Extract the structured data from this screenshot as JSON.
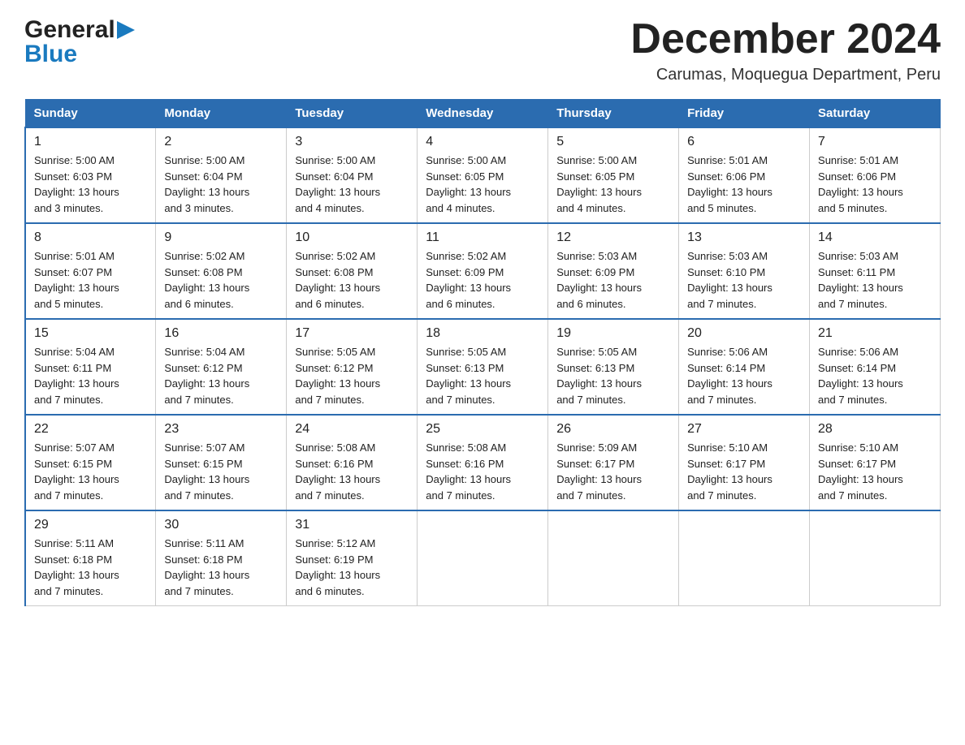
{
  "logo": {
    "general": "General",
    "blue": "Blue",
    "arrow": "▶"
  },
  "title": "December 2024",
  "subtitle": "Carumas, Moquegua Department, Peru",
  "headers": [
    "Sunday",
    "Monday",
    "Tuesday",
    "Wednesday",
    "Thursday",
    "Friday",
    "Saturday"
  ],
  "weeks": [
    [
      {
        "num": "1",
        "info": "Sunrise: 5:00 AM\nSunset: 6:03 PM\nDaylight: 13 hours\nand 3 minutes."
      },
      {
        "num": "2",
        "info": "Sunrise: 5:00 AM\nSunset: 6:04 PM\nDaylight: 13 hours\nand 3 minutes."
      },
      {
        "num": "3",
        "info": "Sunrise: 5:00 AM\nSunset: 6:04 PM\nDaylight: 13 hours\nand 4 minutes."
      },
      {
        "num": "4",
        "info": "Sunrise: 5:00 AM\nSunset: 6:05 PM\nDaylight: 13 hours\nand 4 minutes."
      },
      {
        "num": "5",
        "info": "Sunrise: 5:00 AM\nSunset: 6:05 PM\nDaylight: 13 hours\nand 4 minutes."
      },
      {
        "num": "6",
        "info": "Sunrise: 5:01 AM\nSunset: 6:06 PM\nDaylight: 13 hours\nand 5 minutes."
      },
      {
        "num": "7",
        "info": "Sunrise: 5:01 AM\nSunset: 6:06 PM\nDaylight: 13 hours\nand 5 minutes."
      }
    ],
    [
      {
        "num": "8",
        "info": "Sunrise: 5:01 AM\nSunset: 6:07 PM\nDaylight: 13 hours\nand 5 minutes."
      },
      {
        "num": "9",
        "info": "Sunrise: 5:02 AM\nSunset: 6:08 PM\nDaylight: 13 hours\nand 6 minutes."
      },
      {
        "num": "10",
        "info": "Sunrise: 5:02 AM\nSunset: 6:08 PM\nDaylight: 13 hours\nand 6 minutes."
      },
      {
        "num": "11",
        "info": "Sunrise: 5:02 AM\nSunset: 6:09 PM\nDaylight: 13 hours\nand 6 minutes."
      },
      {
        "num": "12",
        "info": "Sunrise: 5:03 AM\nSunset: 6:09 PM\nDaylight: 13 hours\nand 6 minutes."
      },
      {
        "num": "13",
        "info": "Sunrise: 5:03 AM\nSunset: 6:10 PM\nDaylight: 13 hours\nand 7 minutes."
      },
      {
        "num": "14",
        "info": "Sunrise: 5:03 AM\nSunset: 6:11 PM\nDaylight: 13 hours\nand 7 minutes."
      }
    ],
    [
      {
        "num": "15",
        "info": "Sunrise: 5:04 AM\nSunset: 6:11 PM\nDaylight: 13 hours\nand 7 minutes."
      },
      {
        "num": "16",
        "info": "Sunrise: 5:04 AM\nSunset: 6:12 PM\nDaylight: 13 hours\nand 7 minutes."
      },
      {
        "num": "17",
        "info": "Sunrise: 5:05 AM\nSunset: 6:12 PM\nDaylight: 13 hours\nand 7 minutes."
      },
      {
        "num": "18",
        "info": "Sunrise: 5:05 AM\nSunset: 6:13 PM\nDaylight: 13 hours\nand 7 minutes."
      },
      {
        "num": "19",
        "info": "Sunrise: 5:05 AM\nSunset: 6:13 PM\nDaylight: 13 hours\nand 7 minutes."
      },
      {
        "num": "20",
        "info": "Sunrise: 5:06 AM\nSunset: 6:14 PM\nDaylight: 13 hours\nand 7 minutes."
      },
      {
        "num": "21",
        "info": "Sunrise: 5:06 AM\nSunset: 6:14 PM\nDaylight: 13 hours\nand 7 minutes."
      }
    ],
    [
      {
        "num": "22",
        "info": "Sunrise: 5:07 AM\nSunset: 6:15 PM\nDaylight: 13 hours\nand 7 minutes."
      },
      {
        "num": "23",
        "info": "Sunrise: 5:07 AM\nSunset: 6:15 PM\nDaylight: 13 hours\nand 7 minutes."
      },
      {
        "num": "24",
        "info": "Sunrise: 5:08 AM\nSunset: 6:16 PM\nDaylight: 13 hours\nand 7 minutes."
      },
      {
        "num": "25",
        "info": "Sunrise: 5:08 AM\nSunset: 6:16 PM\nDaylight: 13 hours\nand 7 minutes."
      },
      {
        "num": "26",
        "info": "Sunrise: 5:09 AM\nSunset: 6:17 PM\nDaylight: 13 hours\nand 7 minutes."
      },
      {
        "num": "27",
        "info": "Sunrise: 5:10 AM\nSunset: 6:17 PM\nDaylight: 13 hours\nand 7 minutes."
      },
      {
        "num": "28",
        "info": "Sunrise: 5:10 AM\nSunset: 6:17 PM\nDaylight: 13 hours\nand 7 minutes."
      }
    ],
    [
      {
        "num": "29",
        "info": "Sunrise: 5:11 AM\nSunset: 6:18 PM\nDaylight: 13 hours\nand 7 minutes."
      },
      {
        "num": "30",
        "info": "Sunrise: 5:11 AM\nSunset: 6:18 PM\nDaylight: 13 hours\nand 7 minutes."
      },
      {
        "num": "31",
        "info": "Sunrise: 5:12 AM\nSunset: 6:19 PM\nDaylight: 13 hours\nand 6 minutes."
      },
      {
        "num": "",
        "info": ""
      },
      {
        "num": "",
        "info": ""
      },
      {
        "num": "",
        "info": ""
      },
      {
        "num": "",
        "info": ""
      }
    ]
  ]
}
